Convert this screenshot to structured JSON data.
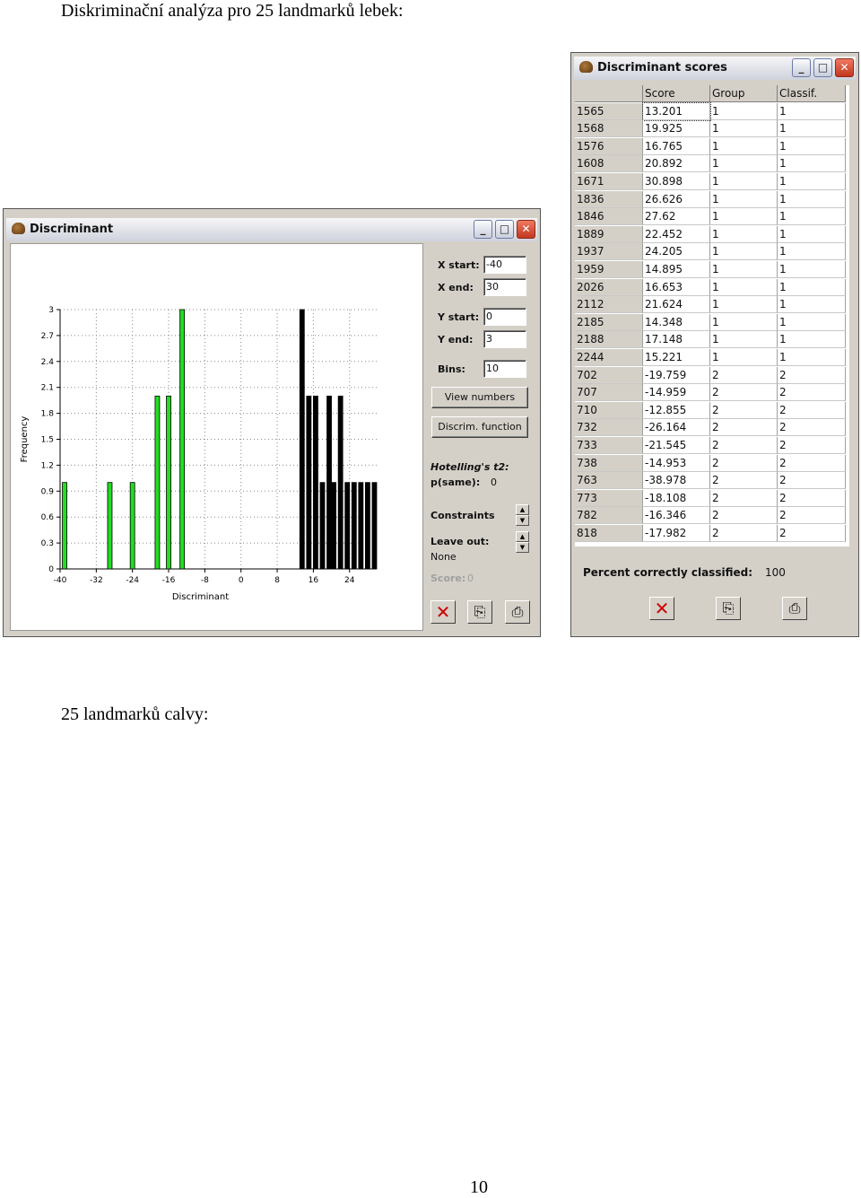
{
  "doc": {
    "heading": "Diskriminační analýza pro 25 landmarků lebek:",
    "subheading": "25 landmarků calvy:",
    "page_number": "10"
  },
  "discriminant_window": {
    "title": "Discriminant",
    "controls": {
      "x_start_label": "X start:",
      "x_start_value": "-40",
      "x_end_label": "X end:",
      "x_end_value": "30",
      "y_start_label": "Y start:",
      "y_start_value": "0",
      "y_end_label": "Y end:",
      "y_end_value": "3",
      "bins_label": "Bins:",
      "bins_value": "10",
      "view_numbers_button": "View numbers",
      "discrim_function_button": "Discrim. function",
      "hotelling_label": "Hotelling's t2:",
      "p_same_label": "p(same):",
      "p_same_value": "0",
      "constraints_label": "Constraints",
      "leave_out_label": "Leave out:",
      "leave_out_value": "None",
      "score_label": "Score:",
      "score_value": "0"
    },
    "colors": {
      "group1": "#000000",
      "group2": "#22dd22"
    }
  },
  "chart_data": {
    "type": "bar",
    "xlabel": "Discriminant",
    "ylabel": "Frequency",
    "xlim": [
      -40,
      30
    ],
    "ylim": [
      0,
      3
    ],
    "x_ticks": [
      "-40",
      "-32",
      "-24",
      "-16",
      "-8",
      "0",
      "8",
      "16",
      "24"
    ],
    "y_ticks": [
      "0",
      "0.3",
      "0.6",
      "0.9",
      "1.2",
      "1.5",
      "1.8",
      "2.1",
      "2.4",
      "2.7",
      "3"
    ],
    "series": [
      {
        "color": "#22dd22",
        "x": [
          -39,
          -29,
          -24,
          -18.5,
          -16,
          -13
        ],
        "values": [
          1,
          1,
          1,
          2,
          2,
          3
        ]
      },
      {
        "color": "#000000",
        "x": [
          13.5,
          15,
          16.5,
          18,
          19.5,
          20.5,
          22,
          23.5,
          25,
          26.5,
          28,
          29.5
        ],
        "values": [
          3,
          2,
          2,
          1,
          2,
          1,
          2,
          1,
          1,
          1,
          1,
          1
        ]
      }
    ]
  },
  "scores_window": {
    "title": "Discriminant scores",
    "columns": [
      "Score",
      "Group",
      "Classif."
    ],
    "rows": [
      [
        "1565",
        "13.201",
        "1",
        "1"
      ],
      [
        "1568",
        "19.925",
        "1",
        "1"
      ],
      [
        "1576",
        "16.765",
        "1",
        "1"
      ],
      [
        "1608",
        "20.892",
        "1",
        "1"
      ],
      [
        "1671",
        "30.898",
        "1",
        "1"
      ],
      [
        "1836",
        "26.626",
        "1",
        "1"
      ],
      [
        "1846",
        "27.62",
        "1",
        "1"
      ],
      [
        "1889",
        "22.452",
        "1",
        "1"
      ],
      [
        "1937",
        "24.205",
        "1",
        "1"
      ],
      [
        "1959",
        "14.895",
        "1",
        "1"
      ],
      [
        "2026",
        "16.653",
        "1",
        "1"
      ],
      [
        "2112",
        "21.624",
        "1",
        "1"
      ],
      [
        "2185",
        "14.348",
        "1",
        "1"
      ],
      [
        "2188",
        "17.148",
        "1",
        "1"
      ],
      [
        "2244",
        "15.221",
        "1",
        "1"
      ],
      [
        "702",
        "-19.759",
        "2",
        "2"
      ],
      [
        "707",
        "-14.959",
        "2",
        "2"
      ],
      [
        "710",
        "-12.855",
        "2",
        "2"
      ],
      [
        "732",
        "-26.164",
        "2",
        "2"
      ],
      [
        "733",
        "-21.545",
        "2",
        "2"
      ],
      [
        "738",
        "-14.953",
        "2",
        "2"
      ],
      [
        "763",
        "-38.978",
        "2",
        "2"
      ],
      [
        "773",
        "-18.108",
        "2",
        "2"
      ],
      [
        "782",
        "-16.346",
        "2",
        "2"
      ],
      [
        "818",
        "-17.982",
        "2",
        "2"
      ]
    ],
    "percent_label": "Percent correctly classified:",
    "percent_value": "100"
  },
  "icons": [
    "close-x-icon",
    "copy-icon",
    "print-icon",
    "minimize-icon",
    "maximize-icon",
    "app-icon"
  ]
}
